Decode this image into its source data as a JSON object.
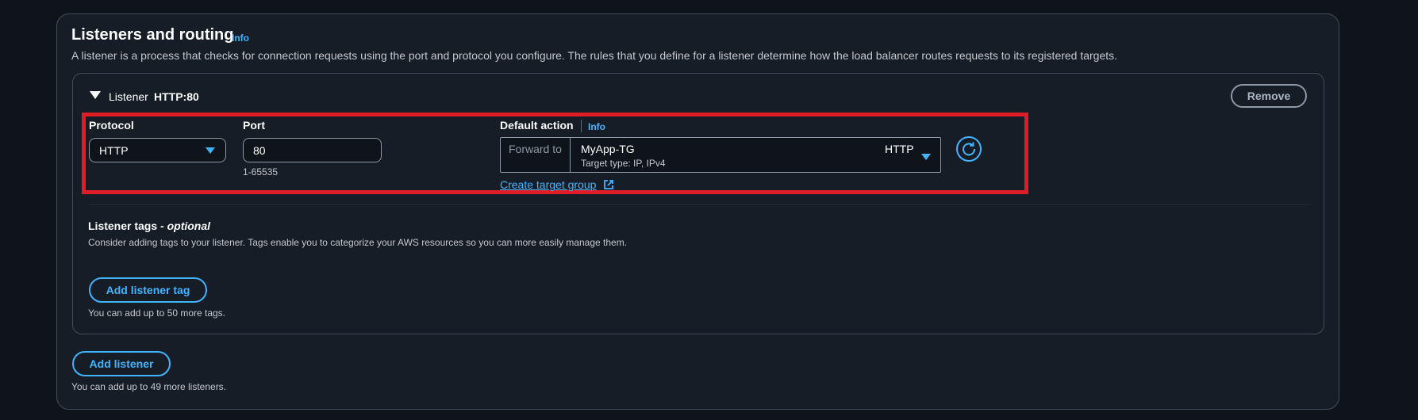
{
  "section": {
    "title": "Listeners and routing",
    "info": "Info",
    "description": "A listener is a process that checks for connection requests using the port and protocol you configure. The rules that you define for a listener determine how the load balancer routes requests to its registered targets."
  },
  "listener": {
    "label": "Listener",
    "value": "HTTP:80",
    "remove_label": "Remove",
    "protocol": {
      "label": "Protocol",
      "value": "HTTP"
    },
    "port": {
      "label": "Port",
      "value": "80",
      "hint": "1-65535"
    },
    "default_action": {
      "label": "Default action",
      "info": "Info",
      "forward_to": "Forward to",
      "target_group_name": "MyApp-TG",
      "target_type": "Target type: IP, IPv4",
      "protocol": "HTTP",
      "create_link": "Create target group"
    },
    "tags": {
      "title": "Listener tags - ",
      "title_optional": "optional",
      "description": "Consider adding tags to your listener. Tags enable you to categorize your AWS resources so you can more easily manage them.",
      "add_button": "Add listener tag",
      "limit_text": "You can add up to 50 more tags."
    }
  },
  "add_listener": {
    "button": "Add listener",
    "limit_text": "You can add up to 49 more listeners."
  },
  "icons": {
    "expand": "caret-down-icon",
    "dropdown": "chevron-down-icon",
    "refresh": "refresh-icon",
    "external": "external-link-icon"
  },
  "colors": {
    "accent": "#42b4ff",
    "highlight": "#e01c26",
    "background": "#0f141a",
    "panel": "#161d26"
  }
}
